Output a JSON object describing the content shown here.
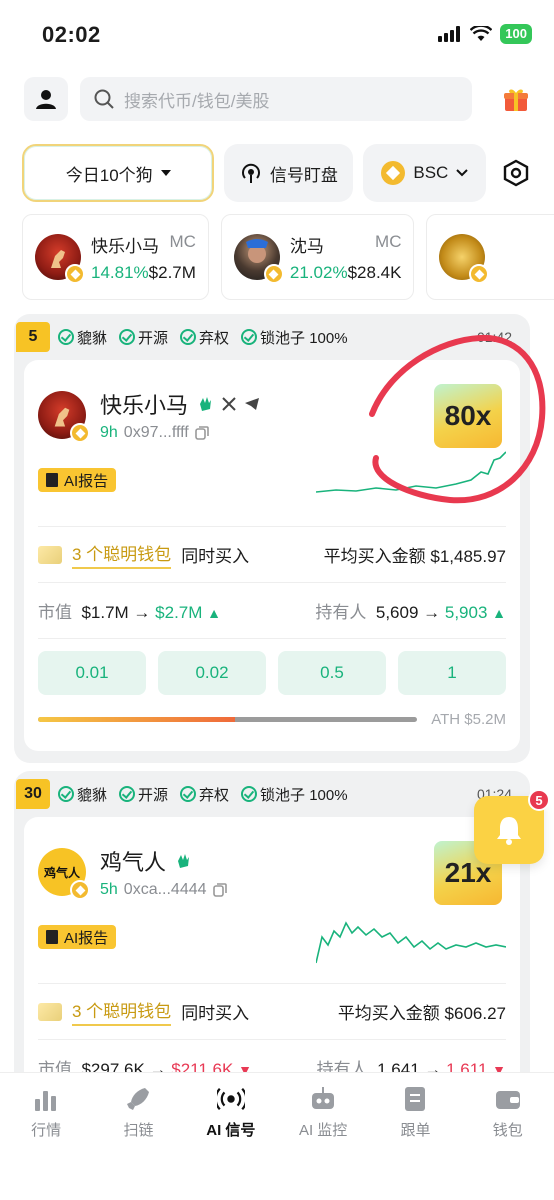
{
  "status_bar": {
    "time": "02:02",
    "battery": "100"
  },
  "search": {
    "placeholder": "搜索代币/钱包/美股"
  },
  "filters": {
    "dogs": "今日10个狗",
    "signal": "信号盯盘",
    "chain": "BSC"
  },
  "tickers": [
    {
      "name": "快乐小马",
      "mc_label": "MC",
      "change": "14.81%",
      "mc": "$2.7M"
    },
    {
      "name": "沈马",
      "mc_label": "MC",
      "change": "21.02%",
      "mc": "$28.4K"
    }
  ],
  "cards": [
    {
      "rank": "5",
      "tags": [
        "貔貅",
        "开源",
        "弃权",
        "锁池子 100%"
      ],
      "timer": "01:42",
      "name": "快乐小马",
      "age": "9h",
      "address": "0x97...ffff",
      "multiplier": "80x",
      "ai_label": "AI报告",
      "smart_count": "3 个聪明钱包",
      "smart_suffix": "同时买入",
      "avg_label": "平均买入金额",
      "avg_value": "$1,485.97",
      "mc_label": "市值",
      "mc_from": "$1.7M",
      "mc_to": "$2.7M",
      "holders_label": "持有人",
      "holders_from": "5,609",
      "holders_to": "5,903",
      "amounts": [
        "0.01",
        "0.02",
        "0.5",
        "1"
      ],
      "ath": "ATH $5.2M",
      "ath_progress": 0.52
    },
    {
      "rank": "30",
      "tags": [
        "貔貅",
        "开源",
        "弃权",
        "锁池子 100%"
      ],
      "timer": "01:24",
      "name": "鸡气人",
      "avatar_text": "鸡气人",
      "age": "5h",
      "address": "0xca...4444",
      "multiplier": "21x",
      "ai_label": "AI报告",
      "smart_count": "3 个聪明钱包",
      "smart_suffix": "同时买入",
      "avg_label": "平均买入金额",
      "avg_value": "$606.27",
      "mc_label": "市值",
      "mc_from": "$297.6K",
      "mc_to": "$211.6K",
      "holders_label": "持有人",
      "holders_from": "1,641",
      "holders_to": "1,611"
    }
  ],
  "notification_count": "5",
  "nav": [
    {
      "label": "行情",
      "icon": "bar-chart-icon"
    },
    {
      "label": "扫链",
      "icon": "rocket-icon"
    },
    {
      "label": "AI 信号",
      "icon": "broadcast-icon"
    },
    {
      "label": "AI 监控",
      "icon": "robot-icon"
    },
    {
      "label": "跟单",
      "icon": "document-icon"
    },
    {
      "label": "钱包",
      "icon": "wallet-icon"
    }
  ],
  "colors": {
    "accent_green": "#19b37c",
    "accent_red": "#e83a55",
    "brand_yellow": "#f7c325",
    "annotation_red": "#e8394f"
  }
}
